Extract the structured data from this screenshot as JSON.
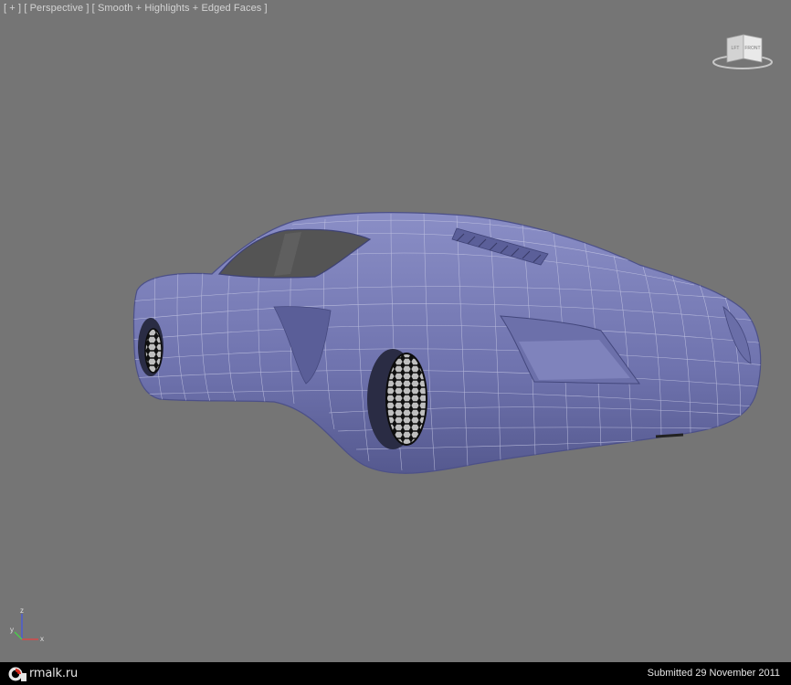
{
  "viewport": {
    "label_plus": "[ + ]",
    "label_view": "[ Perspective ]",
    "label_shading": "[ Smooth + Highlights + Edged Faces ]",
    "background_color": "#757575"
  },
  "viewcube": {
    "left_face": "LFT",
    "front_face": "FRONT"
  },
  "model": {
    "body_color": "#7478b4",
    "wire_color": "#c8cae6",
    "wheel_color": "#1c1c1c"
  },
  "axis_gizmo": {
    "z": "z",
    "y": "y",
    "x": "x"
  },
  "footer": {
    "logo_text": "rmalk.ru",
    "submitted": "Submitted 29 November 2011"
  }
}
